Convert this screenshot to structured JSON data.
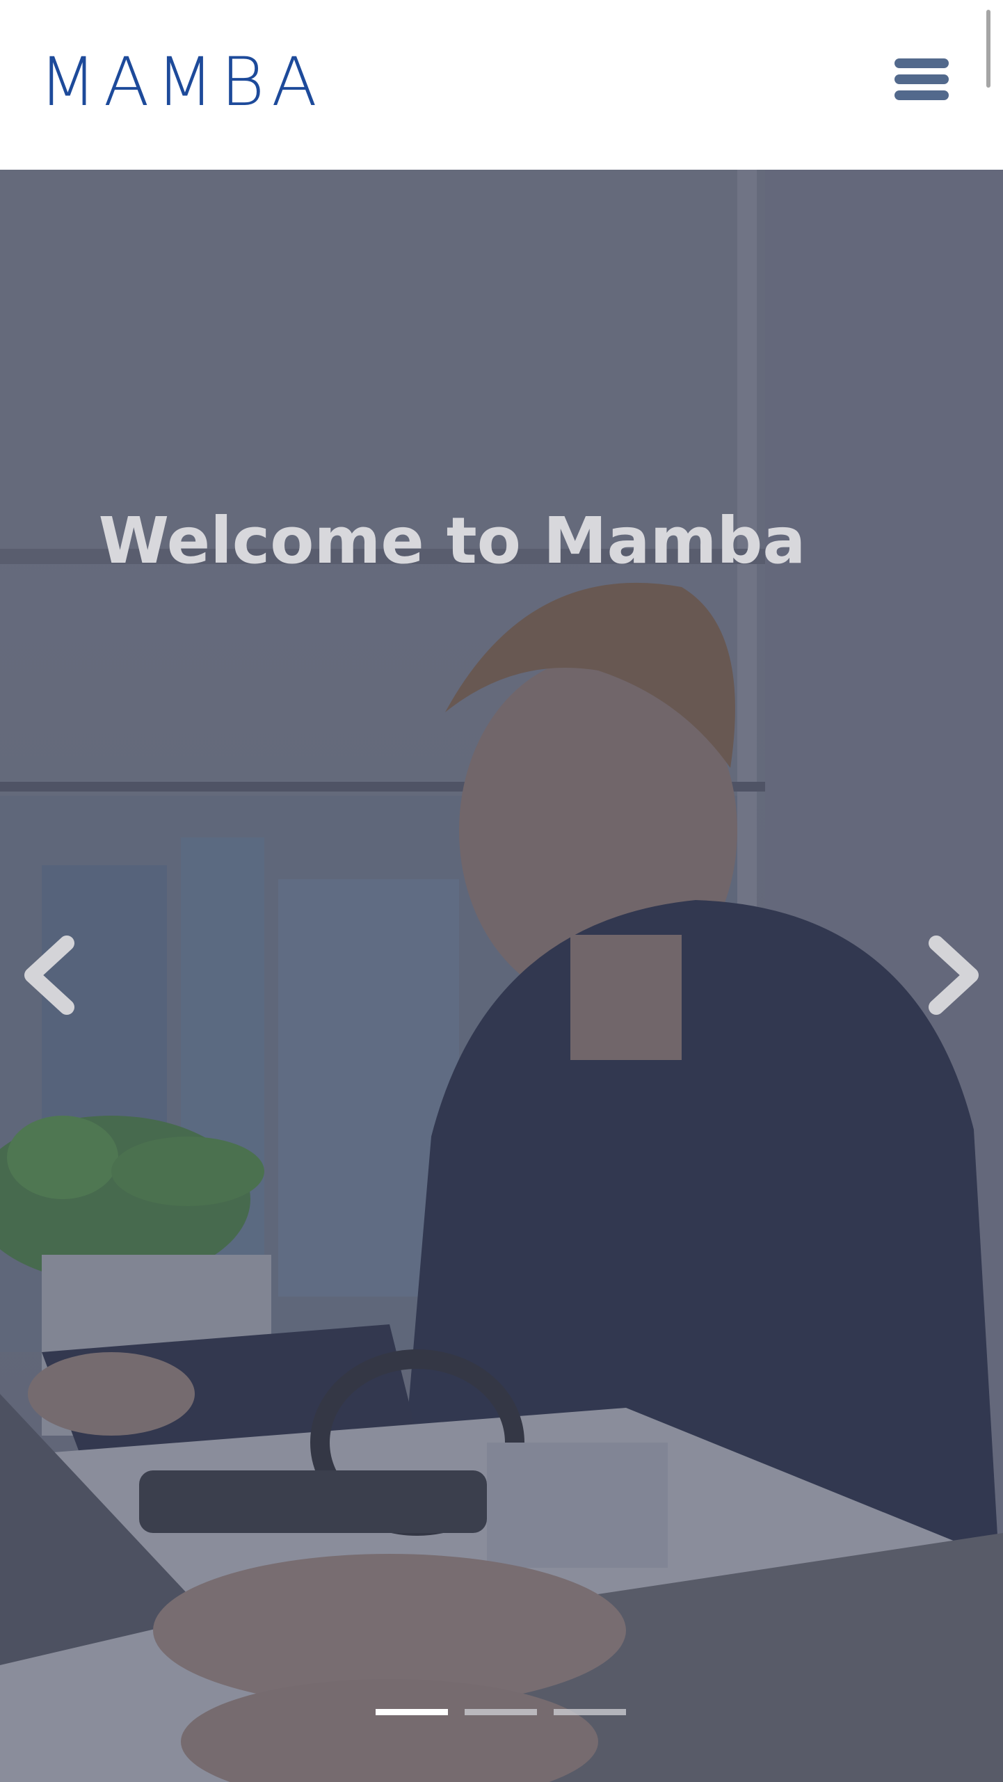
{
  "header": {
    "logo_text": "MAMBA",
    "menu_icon": "hamburger-menu-icon"
  },
  "hero": {
    "title": "Welcome to Mamba",
    "prev_icon": "chevron-left-icon",
    "next_icon": "chevron-right-icon",
    "slide_count": 3,
    "active_slide": 1
  },
  "colors": {
    "brand": "#1d4a9a",
    "menu_icon": "#52698c",
    "overlay": "#4a4f63",
    "title_text": "#d8d8dc"
  }
}
